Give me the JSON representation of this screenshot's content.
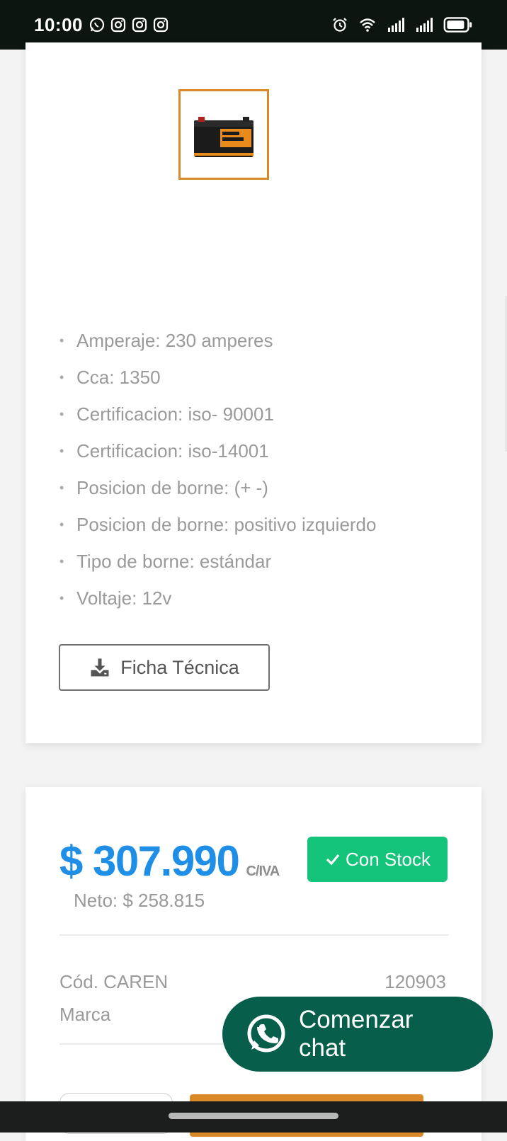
{
  "status_bar": {
    "time": "10:00",
    "left_icons": [
      "whatsapp-icon",
      "instagram-icon",
      "instagram-icon",
      "instagram-icon"
    ],
    "right_icons": [
      "alarm-icon",
      "wifi-icon",
      "signal-icon",
      "signal-icon",
      "battery-icon"
    ]
  },
  "product": {
    "thumbnail_icon": "battery-product-image",
    "thumbnail_border_color": "#d9892a",
    "specs": [
      "Amperaje: 230 amperes",
      "Cca: 1350",
      "Certificacion: iso- 90001",
      "Certificacion: iso-14001",
      "Posicion de borne: (+ -)",
      "Posicion de borne: positivo izquierdo",
      "Tipo de borne: estándar",
      "Voltaje: 12v"
    ],
    "ficha_label": "Ficha Técnica"
  },
  "pricing": {
    "price": "$ 307.990",
    "tax_suffix": "C/IVA",
    "stock_label": "Con Stock",
    "neto": "Neto: $ 258.815",
    "code_label": "Cód. CAREN",
    "code_value": "120903",
    "brand_label": "Marca",
    "price_color": "#1e8ee6",
    "stock_color": "#14c47a",
    "accent_color": "#d9892a"
  },
  "whatsapp_chat": {
    "label_line1": "Comenzar",
    "label_line2": "chat",
    "color": "#075e4a"
  }
}
